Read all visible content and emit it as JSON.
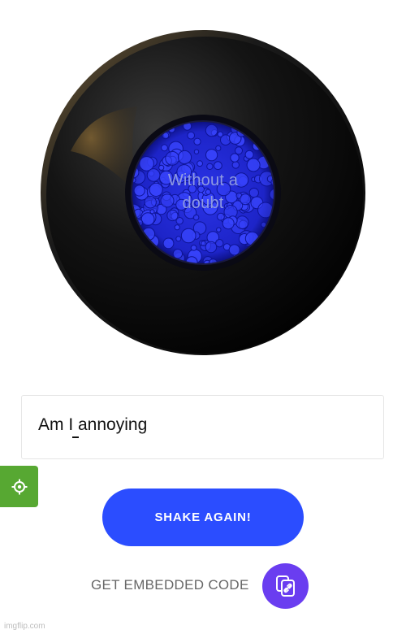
{
  "eight_ball": {
    "answer_line_1": "Without a",
    "answer_line_2": "doubt"
  },
  "question": {
    "value": "Am I annoying"
  },
  "settings_tab": {
    "icon": "settings-icon",
    "color": "#57a832"
  },
  "shake_button": {
    "label": "SHAKE AGAIN!",
    "color": "#2b4dff"
  },
  "embed": {
    "label": "GET EMBEDDED CODE",
    "icon": "copy-link-icon",
    "color": "#6a3df0"
  },
  "watermark": {
    "text": "imgflip.com"
  }
}
